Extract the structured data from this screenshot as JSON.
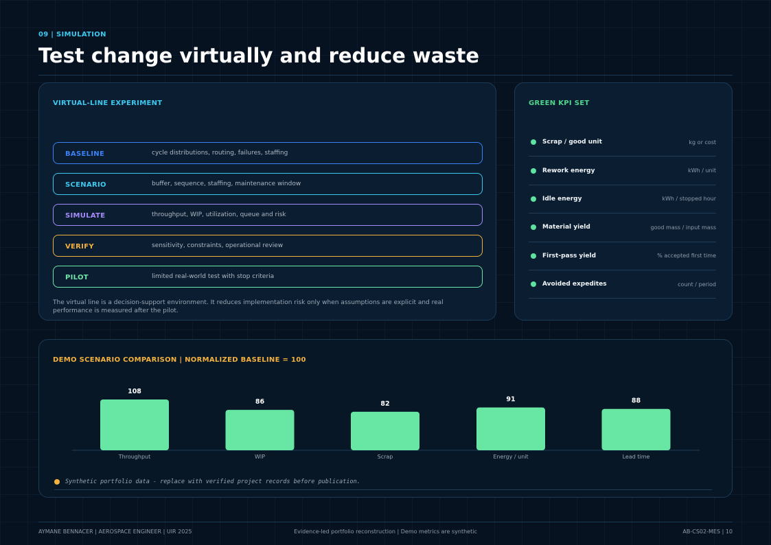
{
  "header": {
    "eyebrow": "09 | SIMULATION",
    "title": "Test change virtually and reduce waste"
  },
  "experiment": {
    "heading": "VIRTUAL-LINE EXPERIMENT",
    "steps": [
      {
        "name": "BASELINE",
        "desc": "cycle distributions, routing, failures, staffing",
        "color": "#3b82f6"
      },
      {
        "name": "SCENARIO",
        "desc": "buffer, sequence, staffing, maintenance window",
        "color": "#3ec8f0"
      },
      {
        "name": "SIMULATE",
        "desc": "throughput, WIP, utilization, queue and risk",
        "color": "#a78bfa"
      },
      {
        "name": "VERIFY",
        "desc": "sensitivity, constraints, operational review",
        "color": "#f3b23e"
      },
      {
        "name": "PILOT",
        "desc": "limited real-world test with stop criteria",
        "color": "#6ee7a8"
      }
    ],
    "note": "The virtual line is a decision-support environment. It reduces implementation risk only when assumptions are explicit and real performance is measured after the pilot."
  },
  "kpi": {
    "heading": "GREEN KPI SET",
    "items": [
      {
        "name": "Scrap / good unit",
        "unit": "kg or cost"
      },
      {
        "name": "Rework energy",
        "unit": "kWh / unit"
      },
      {
        "name": "Idle energy",
        "unit": "kWh / stopped hour"
      },
      {
        "name": "Material yield",
        "unit": "good mass / input mass"
      },
      {
        "name": "First-pass yield",
        "unit": "% accepted first time"
      },
      {
        "name": "Avoided expedites",
        "unit": "count / period"
      }
    ]
  },
  "demo": {
    "heading": "DEMO SCENARIO COMPARISON | NORMALIZED BASELINE = 100",
    "note": "Synthetic portfolio data - replace with verified project records before publication."
  },
  "chart_data": {
    "type": "bar",
    "categories": [
      "Throughput",
      "WIP",
      "Scrap",
      "Energy / unit",
      "Lead time"
    ],
    "values": [
      108,
      86,
      82,
      91,
      88
    ],
    "title": "",
    "xlabel": "",
    "ylabel": "",
    "ylim": [
      0,
      110
    ],
    "grid": false,
    "color": "#68e6a4"
  },
  "footer": {
    "left": "AYMANE BENNACER | AEROSPACE ENGINEER | UIR 2025",
    "center": "Evidence-led portfolio reconstruction | Demo metrics are synthetic",
    "right": "AB-CS02-MES | 10"
  },
  "colors": {
    "background": "#071220",
    "panel": "#0b1e31",
    "accent_cyan": "#3ec8f0",
    "accent_green": "#4fd58c",
    "accent_orange": "#f3b23e"
  }
}
